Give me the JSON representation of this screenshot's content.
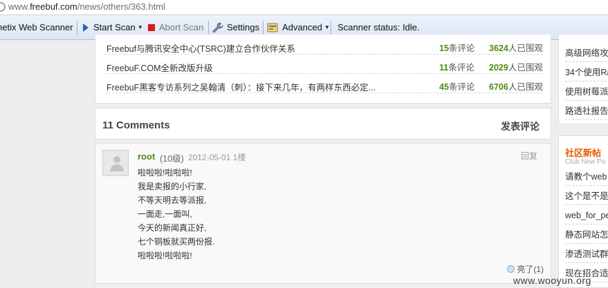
{
  "address_bar": {
    "url_prefix": "www.",
    "url_host": "freebuf.com",
    "url_path": "/news/others/363.html"
  },
  "toolbar": {
    "app_name": "netix Web Scanner",
    "start_scan": "Start Scan",
    "abort_scan": "Abort Scan",
    "settings": "Settings",
    "advanced": "Advanced",
    "status": "Scanner status: Idle."
  },
  "related_articles": [
    {
      "title": "Freebuf与腾讯安全中心(TSRC)建立合作伙伴关系",
      "comments": "15",
      "comments_suffix": "条评论",
      "views": "3624",
      "views_suffix": "人已围观"
    },
    {
      "title": "FreebuF.COM全新改版升级",
      "comments": "11",
      "comments_suffix": "条评论",
      "views": "2029",
      "views_suffix": "人已围观"
    },
    {
      "title": "FreebuF黑客专访系列之吴翰清（刺）：接下来几年，有两样东西必定...",
      "comments": "45",
      "comments_suffix": "条评论",
      "views": "6706",
      "views_suffix": "人已围观"
    }
  ],
  "comments_header": {
    "count_label": "11 Comments",
    "post_label": "发表评论"
  },
  "comment": {
    "author": "root",
    "level": "(10级)",
    "date_floor": "2012-05-01 1楼",
    "reply_label": "回复",
    "lines": [
      "啦啦啦!啦啦啦!",
      "我是卖报的小行家,",
      "不等天明去等派报,",
      "一面走,一面叫,",
      "今天的新闻真正好,",
      "七个铜板就买两份报.",
      "啦啦啦!啦啦啦!"
    ],
    "like_label": "亮了(1)"
  },
  "sidebar_top": {
    "items": [
      "高级网络攻",
      "34个使用Ra",
      "使用树莓派",
      "路透社报告"
    ]
  },
  "sidebar_community": {
    "title": "社区新帖",
    "subtitle": "Club New Po",
    "items": [
      "请教个web",
      "这个是不是",
      "web_for_pe",
      "静态网站怎",
      "渗透测试群",
      "现在招合适"
    ]
  },
  "watermark": "www.wooyun.org",
  "colors": {
    "accent_green": "#4c8a12",
    "community_orange": "#e55a00",
    "abort_red": "#d51b1b",
    "start_blue": "#2d5fb6"
  }
}
